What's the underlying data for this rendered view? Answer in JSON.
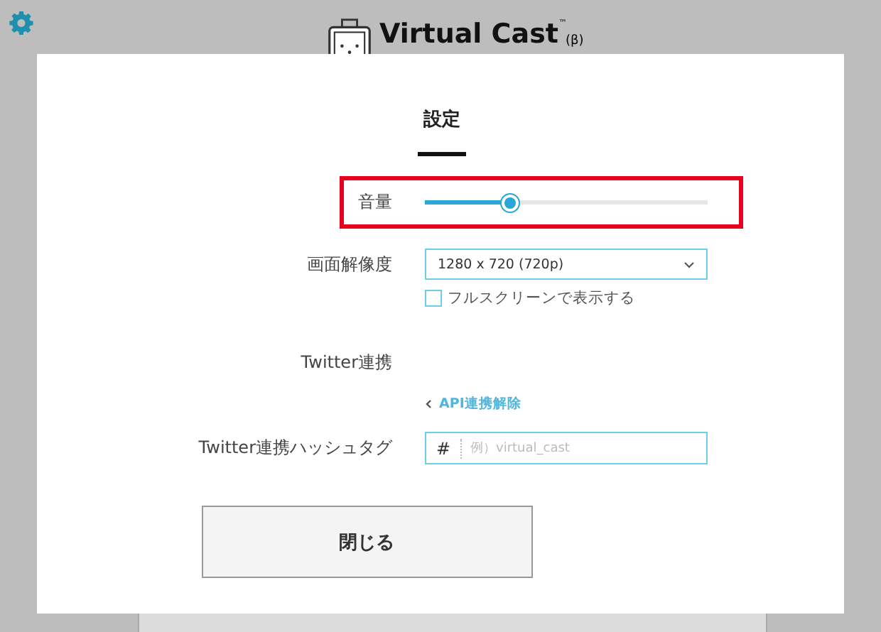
{
  "header": {
    "logo_text": "Virtual Cast",
    "trademark": "™",
    "beta": "(β)"
  },
  "tabs": [
    {
      "label": "設定",
      "selected": true
    }
  ],
  "volume": {
    "label": "音量",
    "level": 0.3,
    "highlighted": true
  },
  "resolution": {
    "label": "画面解像度",
    "value": "1280 x 720 (720p)"
  },
  "fullscreen": {
    "label": "フルスクリーンで表示する",
    "checked": false
  },
  "twitter": {
    "label": "Twitter連携",
    "link": "API連携解除"
  },
  "hashtag": {
    "label": "Twitter連携ハッシュタグ",
    "prefix": "#",
    "placeholder": "例）virtual_cast"
  },
  "buttons": [
    "閉じる"
  ]
}
